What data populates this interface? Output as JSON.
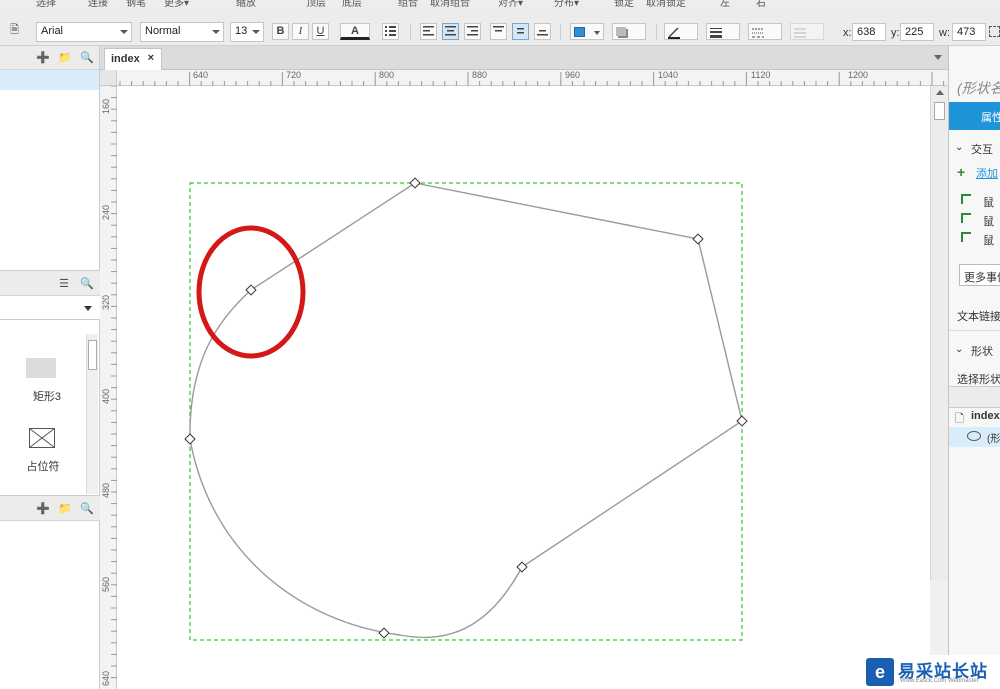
{
  "menu": [
    "选择",
    "连接",
    "钢笔",
    "更多▾",
    "缩放",
    "顶层",
    "底层",
    "组合",
    "取消组合",
    "对齐▾",
    "分布▾",
    "锁定",
    "取消锁定",
    "左",
    "右"
  ],
  "toolbar": {
    "font_family": "Arial",
    "font_style": "Normal",
    "font_size": "13",
    "bold": "B",
    "italic": "I",
    "underline": "U",
    "font_color_glyph": "A",
    "fill_color": "#2d8fd5",
    "x_label": "x:",
    "x_value": "638",
    "y_label": "y:",
    "y_value": "225",
    "w_label": "w:",
    "w_value": "473"
  },
  "tab": {
    "label": "index",
    "close": "×"
  },
  "ruler_top": [
    "640",
    "720",
    "800",
    "880",
    "960",
    "1040",
    "1120",
    "1200"
  ],
  "ruler_left": [
    "160",
    "240",
    "320",
    "400",
    "480",
    "560",
    "640"
  ],
  "widgets": [
    {
      "label": "矩形3",
      "icon": "rectangle-icon"
    },
    {
      "label": "占位符",
      "icon": "placeholder-icon"
    }
  ],
  "right_panel": {
    "title": "(形状名",
    "tab_label": "属性",
    "interaction_section": "交互",
    "add_case": "添加",
    "interaction_rows": [
      "鼠",
      "鼠",
      "鼠"
    ],
    "more_events": "更多事件",
    "text_link": "文本链接",
    "shape_section": "形状",
    "select_shape": "选择形状",
    "outline_page": "index",
    "outline_shape": "(形"
  },
  "watermark": {
    "logo": "e",
    "title": "易采站长站",
    "subtitle": "Www.Easck.Com Webmaster"
  },
  "colors": {
    "selection_border": "#2ecc2e",
    "path_stroke": "#9a9a9a",
    "highlight_ellipse": "#d41818",
    "accent_blue": "#1f94d8"
  }
}
